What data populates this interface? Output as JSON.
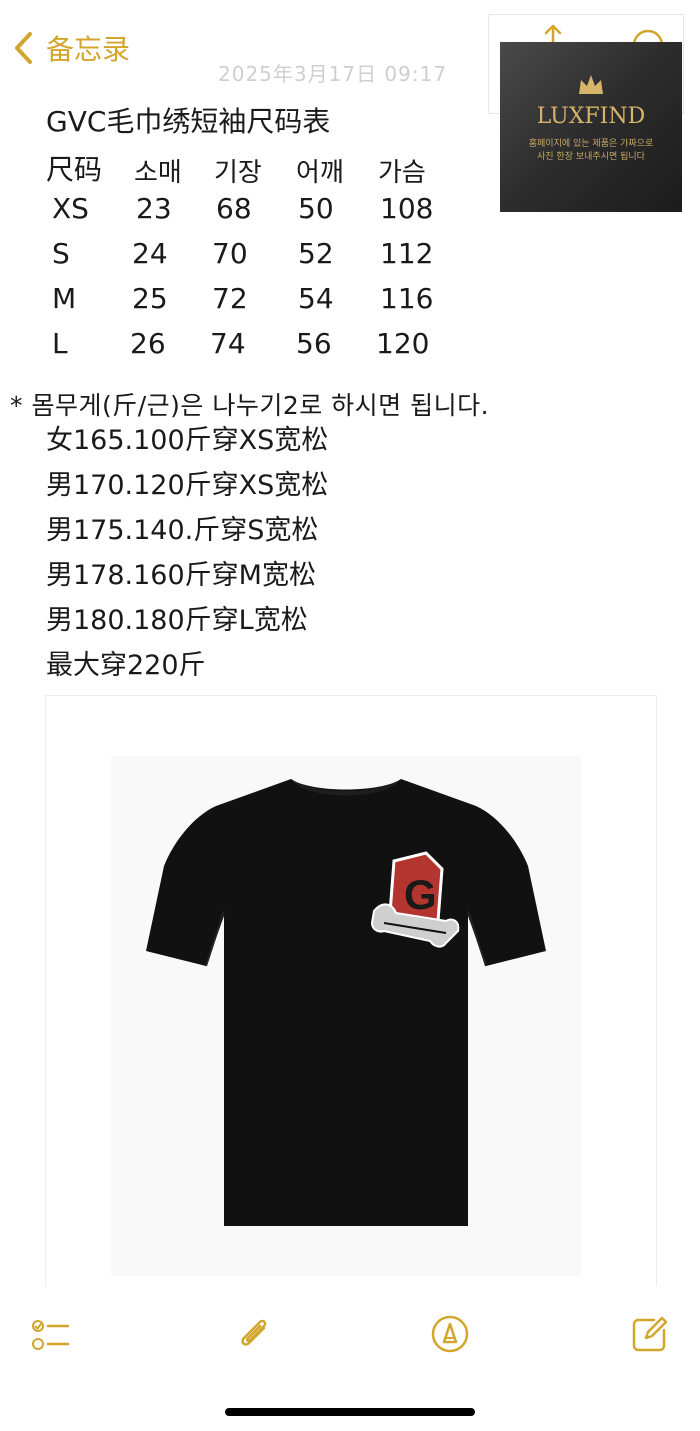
{
  "nav": {
    "back_label": "备忘录",
    "date": "2025年3月17日 09:17"
  },
  "note": {
    "title": "GVC毛巾绣短袖尺码表",
    "table": {
      "headers": [
        "尺码",
        "소매",
        "기장",
        "어깨",
        "가슴"
      ],
      "rows": [
        [
          "XS",
          "23",
          "68",
          "50",
          "108"
        ],
        [
          "S",
          "24",
          "70",
          "52",
          "112"
        ],
        [
          "M",
          "25",
          "72",
          "54",
          "116"
        ],
        [
          "L",
          "26",
          "74",
          "56",
          "120"
        ]
      ]
    },
    "remark": "* 몸무게(斤/근)은 나누기2로 하시면 됩니다.",
    "recommendations": [
      "女165.100斤穿XS宽松",
      "男170.120斤穿XS宽松",
      "男175.140.斤穿S宽松",
      "男178.160斤穿M宽松",
      "男180.180斤穿L宽松",
      "最大穿220斤"
    ]
  },
  "watermark": {
    "brand": "LUXFIND",
    "line1": "홈페이지에 있는 제품은 가짜으로",
    "line2": "사진 한장 보내주시면 됩니다"
  },
  "toolbar": {
    "icons": [
      "checklist-icon",
      "paperclip-icon",
      "markup-pen-icon",
      "compose-icon"
    ]
  },
  "colors": {
    "accent": "#d2a52b"
  }
}
